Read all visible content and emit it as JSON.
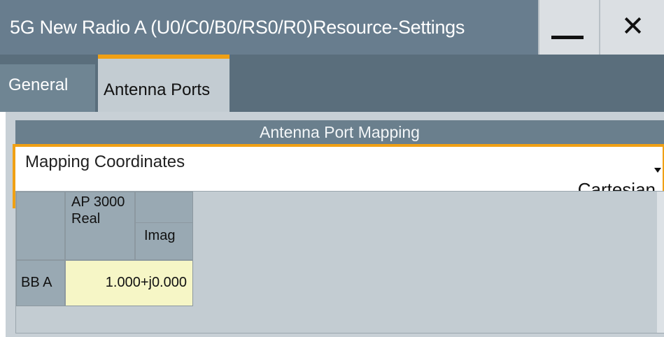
{
  "window": {
    "title": "5G New Radio A (U0/C0/B0/RS0/R0)Resource-Settings",
    "close_symbol": "✕"
  },
  "tabs": [
    {
      "label": "General",
      "active": false
    },
    {
      "label": "Antenna Ports",
      "active": true
    }
  ],
  "section": {
    "title": "Antenna Port Mapping"
  },
  "mapping": {
    "label": "Mapping Coordinates",
    "value": "Cartesian"
  },
  "table": {
    "column_group": "AP 3000",
    "columns": [
      "Real",
      "Imag"
    ],
    "rows": [
      {
        "label": "BB A",
        "value": "1.000+j0.000"
      }
    ]
  },
  "colors": {
    "titlebar": "#687d8e",
    "accent": "#f0a014",
    "cell_highlight": "#f6f6c6"
  }
}
